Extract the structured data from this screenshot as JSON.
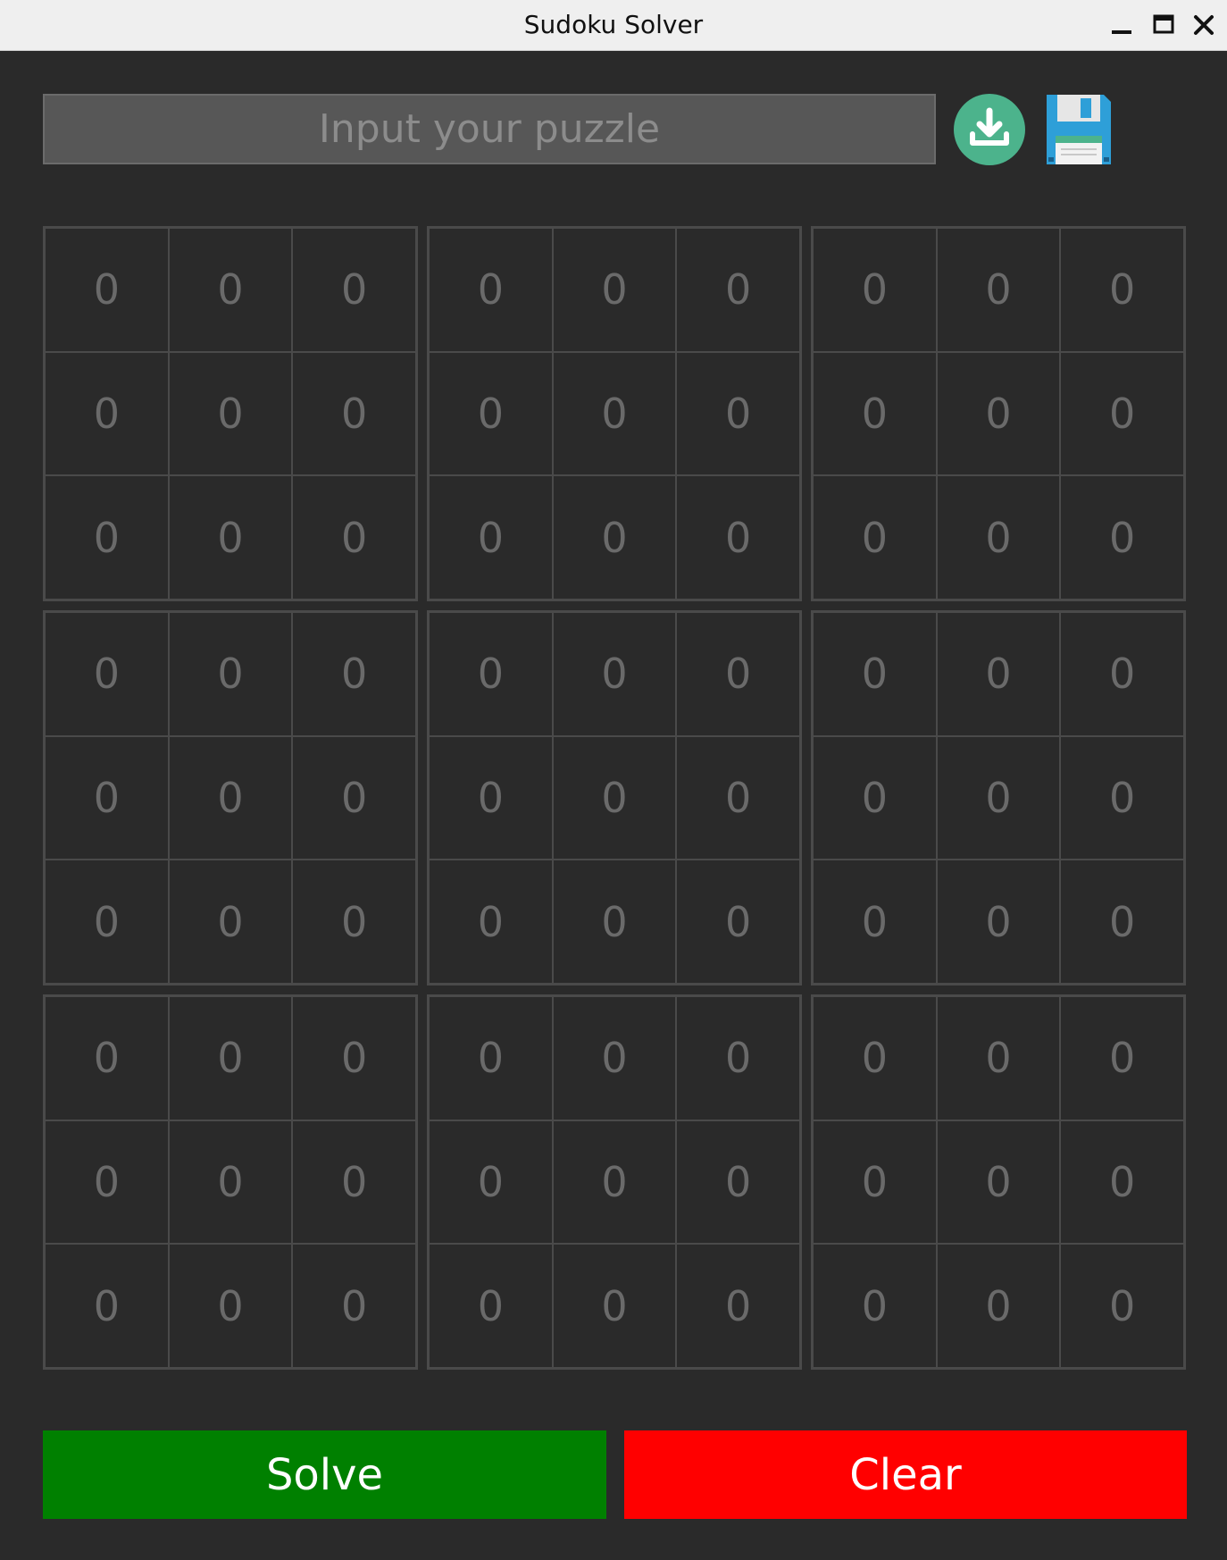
{
  "window": {
    "title": "Sudoku Solver"
  },
  "puzzle_input": {
    "value": "",
    "placeholder": "Input your puzzle"
  },
  "toolbar": {
    "load_icon": "download-icon",
    "save_icon": "floppy-disk-icon"
  },
  "board": {
    "rows": [
      [
        "0",
        "0",
        "0",
        "0",
        "0",
        "0",
        "0",
        "0",
        "0"
      ],
      [
        "0",
        "0",
        "0",
        "0",
        "0",
        "0",
        "0",
        "0",
        "0"
      ],
      [
        "0",
        "0",
        "0",
        "0",
        "0",
        "0",
        "0",
        "0",
        "0"
      ],
      [
        "0",
        "0",
        "0",
        "0",
        "0",
        "0",
        "0",
        "0",
        "0"
      ],
      [
        "0",
        "0",
        "0",
        "0",
        "0",
        "0",
        "0",
        "0",
        "0"
      ],
      [
        "0",
        "0",
        "0",
        "0",
        "0",
        "0",
        "0",
        "0",
        "0"
      ],
      [
        "0",
        "0",
        "0",
        "0",
        "0",
        "0",
        "0",
        "0",
        "0"
      ],
      [
        "0",
        "0",
        "0",
        "0",
        "0",
        "0",
        "0",
        "0",
        "0"
      ],
      [
        "0",
        "0",
        "0",
        "0",
        "0",
        "0",
        "0",
        "0",
        "0"
      ]
    ]
  },
  "actions": {
    "solve_label": "Solve",
    "clear_label": "Clear"
  },
  "colors": {
    "background": "#2a2a2a",
    "solve": "#008000",
    "clear": "#ff0000",
    "load_icon": "#4cb38c",
    "save_icon": "#2e9fd8"
  }
}
